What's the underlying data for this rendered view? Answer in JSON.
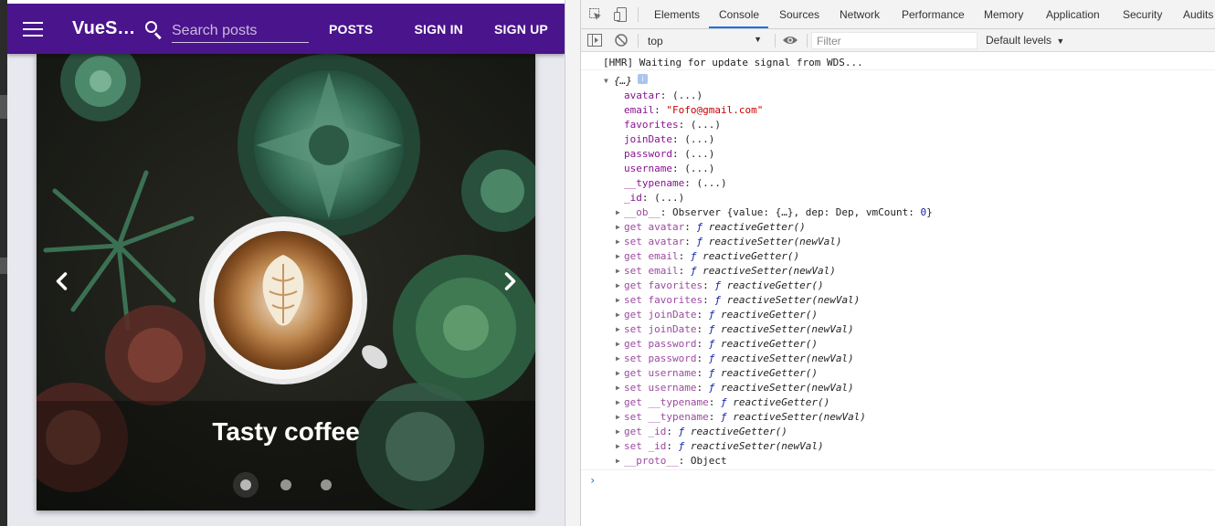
{
  "app": {
    "brand": "VueShare",
    "search": {
      "placeholder": "Search posts",
      "value": ""
    },
    "nav": {
      "posts": "POSTS",
      "sign_in": "SIGN IN",
      "sign_up": "SIGN UP"
    },
    "colors": {
      "toolbar": "#4a148c"
    },
    "carousel": {
      "caption": "Tasty coffee",
      "dots": 3,
      "active_dot": 0
    }
  },
  "devtools": {
    "tabs": [
      "Elements",
      "Console",
      "Sources",
      "Network",
      "Performance",
      "Memory",
      "Application",
      "Security",
      "Audits"
    ],
    "active_tab": "Console",
    "context": "top",
    "filter_placeholder": "Filter",
    "levels": "Default levels",
    "console": {
      "hmr_message": "[HMR] Waiting for update signal from WDS...",
      "object_summary": "{…}",
      "info_badge": "i",
      "properties": [
        {
          "key": "avatar",
          "value": "(...)"
        },
        {
          "key": "email",
          "value": "\"Fofo@gmail.com\""
        },
        {
          "key": "favorites",
          "value": "(...)"
        },
        {
          "key": "joinDate",
          "value": "(...)"
        },
        {
          "key": "password",
          "value": "(...)"
        },
        {
          "key": "username",
          "value": "(...)"
        },
        {
          "key": "__typename",
          "value": "(...)"
        },
        {
          "key": "_id",
          "value": "(...)"
        }
      ],
      "observer_line": {
        "key": "__ob__",
        "value_a": "Observer {value: {…}, dep: Dep, vmCount: ",
        "value_b": "0",
        "value_c": "}"
      },
      "accessors": [
        {
          "kind": "get",
          "name": "avatar",
          "fn": "reactiveGetter()"
        },
        {
          "kind": "set",
          "name": "avatar",
          "fn": "reactiveSetter(newVal)"
        },
        {
          "kind": "get",
          "name": "email",
          "fn": "reactiveGetter()"
        },
        {
          "kind": "set",
          "name": "email",
          "fn": "reactiveSetter(newVal)"
        },
        {
          "kind": "get",
          "name": "favorites",
          "fn": "reactiveGetter()"
        },
        {
          "kind": "set",
          "name": "favorites",
          "fn": "reactiveSetter(newVal)"
        },
        {
          "kind": "get",
          "name": "joinDate",
          "fn": "reactiveGetter()"
        },
        {
          "kind": "set",
          "name": "joinDate",
          "fn": "reactiveSetter(newVal)"
        },
        {
          "kind": "get",
          "name": "password",
          "fn": "reactiveGetter()"
        },
        {
          "kind": "set",
          "name": "password",
          "fn": "reactiveSetter(newVal)"
        },
        {
          "kind": "get",
          "name": "username",
          "fn": "reactiveGetter()"
        },
        {
          "kind": "set",
          "name": "username",
          "fn": "reactiveSetter(newVal)"
        },
        {
          "kind": "get",
          "name": "__typename",
          "fn": "reactiveGetter()"
        },
        {
          "kind": "set",
          "name": "__typename",
          "fn": "reactiveSetter(newVal)"
        },
        {
          "kind": "get",
          "name": "_id",
          "fn": "reactiveGetter()"
        },
        {
          "kind": "set",
          "name": "_id",
          "fn": "reactiveSetter(newVal)"
        }
      ],
      "proto_line": {
        "key": "__proto__",
        "value": "Object"
      },
      "prompt": "›"
    }
  }
}
